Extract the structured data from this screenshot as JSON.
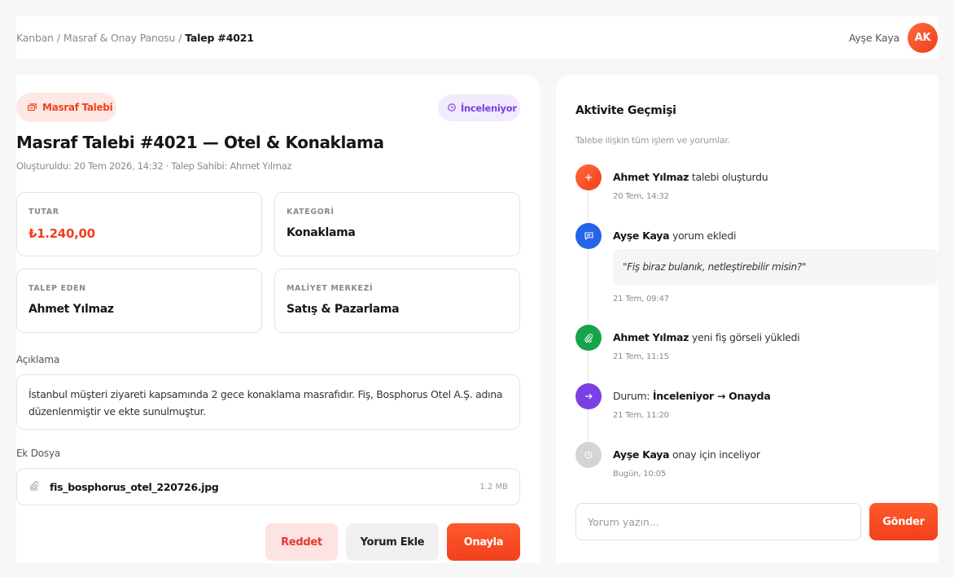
{
  "breadcrumb": {
    "items": [
      "Kanban",
      "Masraf & Onay Panosu"
    ],
    "current": "Talep #4021",
    "separator": "/"
  },
  "user": {
    "name": "Ayşe Kaya",
    "initials": "AK",
    "avatar_color": "#f2401d"
  },
  "request": {
    "tag": "Masraf Talebi",
    "tag_icon": "receipt-icon",
    "status": "İnceleniyor",
    "status_icon": "clock-icon",
    "status_color": "#7b3fe4",
    "title": "Masraf Talebi #4021 — Otel & Konaklama",
    "meta": "Oluşturuldu: 20 Tem 2026, 14:32 · Talep Sahibi: Ahmet Yılmaz",
    "fields": {
      "amount": {
        "label": "TUTAR",
        "value": "₺1.240,00"
      },
      "category": {
        "label": "KATEGORİ",
        "value": "Konaklama"
      },
      "requester": {
        "label": "TALEP EDEN",
        "value": "Ahmet Yılmaz"
      },
      "cost_center": {
        "label": "MALİYET MERKEZİ",
        "value": "Satış & Pazarlama"
      }
    },
    "description_label": "Açıklama",
    "description": "İstanbul müşteri ziyareti kapsamında 2 gece konaklama masrafıdır. Fiş, Bosphorus Otel A.Ş. adına düzenlenmiştir ve ekte sunulmuştur.",
    "attachment_label": "Ek Dosya",
    "attachment": {
      "name": "fis_bosphorus_otel_220726.jpg",
      "size": "1.2 MB",
      "icon": "paperclip-icon"
    },
    "actions": {
      "reject": "Reddet",
      "comment": "Yorum Ekle",
      "approve": "Onayla"
    }
  },
  "activity": {
    "title": "Aktivite Geçmişi",
    "subtitle": "Talebe ilişkin tüm işlem ve yorumlar.",
    "events": [
      {
        "actor": "Ahmet Yılmaz",
        "text": "talebi oluşturdu",
        "time": "20 Tem, 14:32",
        "icon": "plus-icon",
        "color": "#f2401d"
      },
      {
        "actor": "Ayşe Kaya",
        "text": "yorum ekledi",
        "quote": "\"Fiş biraz bulanık, netleştirebilir misin?\"",
        "time": "21 Tem, 09:47",
        "icon": "comment-icon",
        "color": "#2563eb"
      },
      {
        "actor": "Ahmet Yılmaz",
        "text": "yeni fiş görseli yükledi",
        "time": "21 Tem, 11:15",
        "icon": "paperclip-icon",
        "color": "#16a34a"
      },
      {
        "prefix": "Durum:",
        "actor": "İnceleniyor → Onayda",
        "text": "",
        "time": "21 Tem, 11:20",
        "icon": "arrow-right-icon",
        "color": "#7b3fe4"
      },
      {
        "actor": "Ayşe Kaya",
        "text": "onay için inceliyor",
        "time": "Bugün, 10:05",
        "icon": "clock-icon",
        "color": "#cfcfcf"
      }
    ],
    "comment_placeholder": "Yorum yazın...",
    "send_label": "Gönder"
  }
}
